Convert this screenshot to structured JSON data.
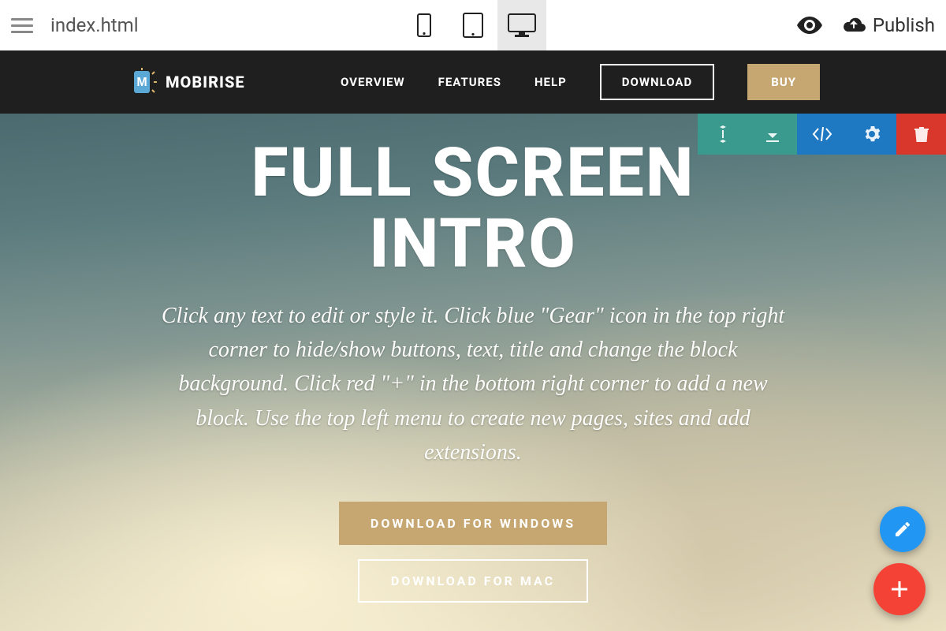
{
  "toolbar": {
    "file_name": "index.html",
    "publish_label": "Publish"
  },
  "nav": {
    "brand": "MOBIRISE",
    "links": [
      "OVERVIEW",
      "FEATURES",
      "HELP"
    ],
    "download_label": "DOWNLOAD",
    "buy_label": "BUY"
  },
  "hero": {
    "title_line1": "FULL SCREEN",
    "title_line2": "INTRO",
    "subtitle": "Click any text to edit or style it. Click blue \"Gear\" icon in the top right corner to hide/show buttons, text, title and change the block background. Click red \"+\" in the bottom right corner to add a new block. Use the top left menu to create new pages, sites and add extensions.",
    "btn_windows": "DOWNLOAD FOR WINDOWS",
    "btn_mac": "DOWNLOAD FOR MAC"
  }
}
